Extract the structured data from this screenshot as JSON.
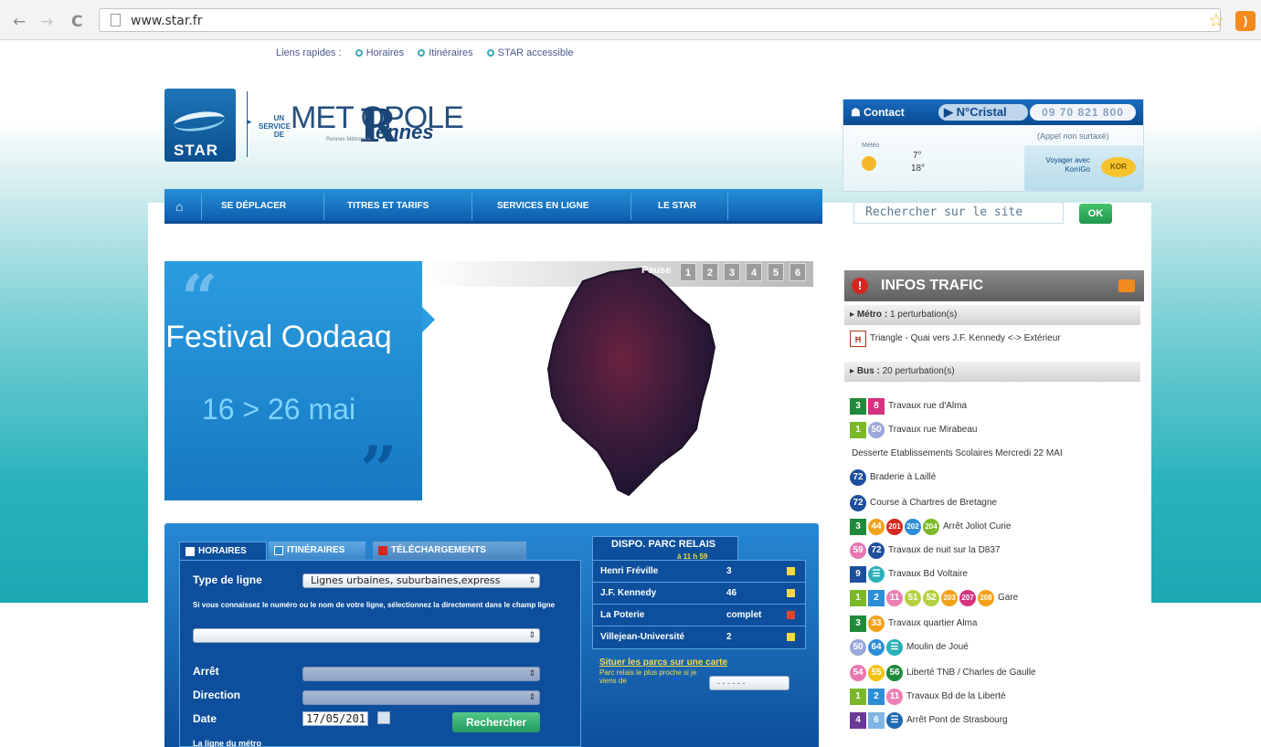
{
  "browser": {
    "url": "www.star.fr",
    "back": "←",
    "forward": "→",
    "reload": "C"
  },
  "quicklinks": {
    "label": "Liens rapides :",
    "items": [
      "Horaires",
      "Itinéraires",
      "STAR accessible"
    ]
  },
  "logo": {
    "star": "STAR",
    "un_service_de": "UN SERVICE DE",
    "metropole": "MET OPOLE",
    "rennes": "ennes",
    "r_letter": "R",
    "tag": "Rennes Métropole"
  },
  "mainnav": {
    "items": [
      "SE DÉPLACER",
      "TITRES ET TARIFS",
      "SERVICES EN LIGNE",
      "LE STAR"
    ]
  },
  "contact": {
    "label": "Contact",
    "cristal": "N°Cristal",
    "phone": "09 70 821 800",
    "appel": "(Appel non surtaxé)",
    "meteo": "Météo",
    "temp_min": "7°",
    "temp_max": "18°",
    "koroo": "Voyager avec KorriGo",
    "koroo_icon": "KOR"
  },
  "search": {
    "placeholder": "Rechercher sur le site",
    "ok": "OK"
  },
  "slider": {
    "title": "Festival Oodaaq",
    "date": "16 > 26 mai",
    "pause": "Pause",
    "pages": [
      "1",
      "2",
      "3",
      "4",
      "5",
      "6"
    ]
  },
  "form": {
    "tabs": [
      "HORAIRES",
      "ITINÉRAIRES",
      "TÉLÉCHARGEMENTS"
    ],
    "type_ligne_label": "Type de ligne",
    "type_ligne_value": "Lignes urbaines, suburbaines,express",
    "hint": "Si vous connaissez le numéro ou le nom de votre ligne, sélectionnez la directement dans le champ ligne",
    "arret_label": "Arrêt",
    "direction_label": "Direction",
    "date_label": "Date",
    "date_value": "17/05/201",
    "search_btn": "Rechercher",
    "metro_line": "La ligne du métro"
  },
  "parc": {
    "title": "DISPO. PARC RELAIS",
    "time": "à 11 h 59",
    "rows": [
      {
        "name": "Henri Fréville",
        "value": "3",
        "status": "yellow"
      },
      {
        "name": "J.F. Kennedy",
        "value": "46",
        "status": "yellow"
      },
      {
        "name": "La Poterie",
        "value": "complet",
        "status": "red"
      },
      {
        "name": "Villejean-Université",
        "value": "2",
        "status": "yellow"
      }
    ],
    "link": "Situer les parcs sur une carte",
    "note": "Parc relais le plus proche si je viens de",
    "select": "- - - - - -"
  },
  "traffic": {
    "title": "INFOS TRAFIC",
    "metro_label": "Métro :",
    "metro_count": "1 perturbation(s)",
    "metro_line": "Triangle - Quai vers J.F. Kennedy <-> Extérieur",
    "bus_label": "Bus :",
    "bus_count": "20 perturbation(s)",
    "items": [
      {
        "badges": [
          {
            "t": "3",
            "c": "#1f8a3b",
            "s": "sq"
          },
          {
            "t": "8",
            "c": "#d6327f",
            "s": "sq"
          }
        ],
        "text": "Travaux rue d'Alma"
      },
      {
        "badges": [
          {
            "t": "1",
            "c": "#7ab929",
            "s": "sq"
          },
          {
            "t": "50",
            "c": "#9aa7da",
            "s": "circ"
          }
        ],
        "text": "Travaux rue Mirabeau"
      },
      {
        "badges": [],
        "text": "Desserte Etablissements Scolaires Mercredi 22 MAI"
      },
      {
        "badges": [
          {
            "t": "72",
            "c": "#1d4f9e",
            "s": "circ"
          }
        ],
        "text": "Braderie à Laillé"
      },
      {
        "badges": [
          {
            "t": "72",
            "c": "#1d4f9e",
            "s": "circ"
          }
        ],
        "text": "Course à Chartres de Bretagne"
      },
      {
        "badges": [
          {
            "t": "3",
            "c": "#1f8a3b",
            "s": "sq"
          },
          {
            "t": "44",
            "c": "#f4a21a",
            "s": "circ"
          },
          {
            "t": "201",
            "c": "#d62a21",
            "s": "circ"
          },
          {
            "t": "202",
            "c": "#2d8ed8",
            "s": "circ"
          },
          {
            "t": "204",
            "c": "#7ab929",
            "s": "circ"
          }
        ],
        "text": "Arrêt Joliot Curie"
      },
      {
        "badges": [
          {
            "t": "59",
            "c": "#e876b0",
            "s": "circ"
          },
          {
            "t": "72",
            "c": "#1d4f9e",
            "s": "circ"
          }
        ],
        "text": "Travaux de nuit sur la D837"
      },
      {
        "badges": [
          {
            "t": "9",
            "c": "#1d4f9e",
            "s": "sq"
          },
          {
            "t": "☰",
            "c": "#2ab0b8",
            "s": "circ"
          }
        ],
        "text": "Travaux Bd Voltaire"
      },
      {
        "badges": [
          {
            "t": "1",
            "c": "#7ab929",
            "s": "sq"
          },
          {
            "t": "2",
            "c": "#2d8ed8",
            "s": "sq"
          },
          {
            "t": "11",
            "c": "#ec7fb4",
            "s": "circ"
          },
          {
            "t": "51",
            "c": "#b6d240",
            "s": "circ"
          },
          {
            "t": "52",
            "c": "#b6d240",
            "s": "circ"
          },
          {
            "t": "203",
            "c": "#f4a21a",
            "s": "circ"
          },
          {
            "t": "207",
            "c": "#d6327f",
            "s": "circ"
          },
          {
            "t": "208",
            "c": "#f4a21a",
            "s": "circ"
          }
        ],
        "text": "Gare"
      },
      {
        "badges": [
          {
            "t": "3",
            "c": "#1f8a3b",
            "s": "sq"
          },
          {
            "t": "33",
            "c": "#f4a21a",
            "s": "circ"
          }
        ],
        "text": "Travaux quartier Alma"
      },
      {
        "badges": [
          {
            "t": "50",
            "c": "#9aa7da",
            "s": "circ"
          },
          {
            "t": "64",
            "c": "#2d8ed8",
            "s": "circ"
          },
          {
            "t": "☰",
            "c": "#2ab0b8",
            "s": "circ"
          }
        ],
        "text": "Moulin de Joué"
      },
      {
        "badges": [
          {
            "t": "54",
            "c": "#e876b0",
            "s": "circ"
          },
          {
            "t": "55",
            "c": "#f4c20e",
            "s": "circ"
          },
          {
            "t": "56",
            "c": "#1f8a3b",
            "s": "circ"
          }
        ],
        "text": "Liberté TNB / Charles de Gaulle"
      },
      {
        "badges": [
          {
            "t": "1",
            "c": "#7ab929",
            "s": "sq"
          },
          {
            "t": "2",
            "c": "#2d8ed8",
            "s": "sq"
          },
          {
            "t": "11",
            "c": "#ec7fb4",
            "s": "circ"
          }
        ],
        "text": "Travaux Bd de la Liberté"
      },
      {
        "badges": [
          {
            "t": "4",
            "c": "#6a3a98",
            "s": "sq"
          },
          {
            "t": "6",
            "c": "#7fb6e3",
            "s": "sq"
          },
          {
            "t": "☰",
            "c": "#1d6ab0",
            "s": "circ"
          }
        ],
        "text": "Arrêt Pont de Strasbourg"
      }
    ]
  },
  "colors": {
    "brand_blue": "#1a6bbf",
    "teal": "#2bb3bd",
    "accent_green": "#22985c"
  }
}
